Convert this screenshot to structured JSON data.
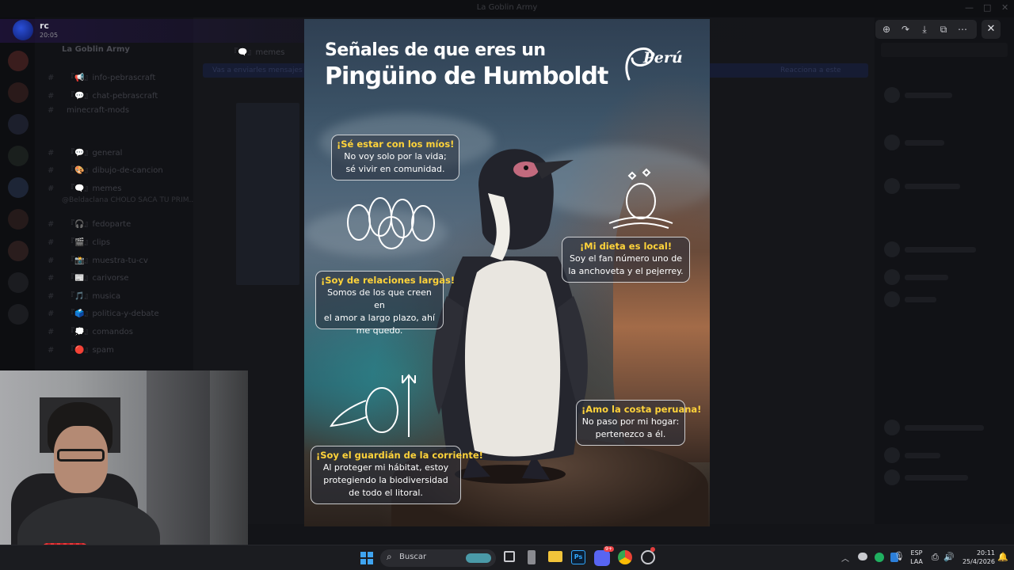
{
  "window": {
    "title": "La Goblin Army"
  },
  "viewer": {
    "user_name": "rc",
    "timestamp": "20:05",
    "toolbar": [
      "zoom-in-icon",
      "forward-icon",
      "download-icon",
      "open-external-icon",
      "more-icon"
    ],
    "close_label": "✕"
  },
  "background_app": {
    "server_name": "La Goblin Army",
    "channel_header": "『🗨️』memes",
    "notice": "Vas a enviarles mensajes a todos los miembros de este canal",
    "notice_right": "Reacciona a este",
    "channels": [
      "『📢』info-pebrascraft",
      "『💬』chat-pebrascraft",
      "minecraft-mods",
      "『💬』general",
      "『🎨』dibujo-de-cancion",
      "『🗨️』memes",
      "『🎧』fedoparte",
      "『🎬』clips",
      "『📸』muestra-tu-cv",
      "『📰』carivorse",
      "『🎵』musica",
      "『🗳️』politica-y-debate",
      "『💭』comandos",
      "『🔴』spam"
    ],
    "category_label": "@Beldaclana CHOLO SACA TU PRIM..."
  },
  "poster": {
    "title_line1": "Señales de que eres un",
    "title_line2": "Pingüino de Humboldt",
    "brand": "Perú",
    "bubbles": [
      {
        "head": "¡Sé estar con los míos!",
        "body": [
          "No voy solo por la vida;",
          "sé vivir en comunidad."
        ]
      },
      {
        "head": "¡Mi dieta es local!",
        "body": [
          "Soy el fan número uno de",
          "la anchoveta y el pejerrey."
        ]
      },
      {
        "head": "¡Soy de relaciones largas!",
        "body": [
          "Somos de los que creen en",
          "el amor a largo plazo, ahí",
          "me quedo."
        ]
      },
      {
        "head": "¡Amo la costa peruana!",
        "body": [
          "No paso por mi hogar:",
          "pertenezco a él."
        ]
      },
      {
        "head": "¡Soy el guardián de la corriente!",
        "body": [
          "Al proteger mi hábitat, estoy",
          "protegiendo la biodiversidad",
          "de todo el litoral."
        ]
      }
    ]
  },
  "taskbar": {
    "search_placeholder": "Buscar",
    "lang_line1": "ESP",
    "lang_line2": "LAA",
    "time": "20:11",
    "date": "25/4/2026",
    "discord_badge": "9+"
  }
}
